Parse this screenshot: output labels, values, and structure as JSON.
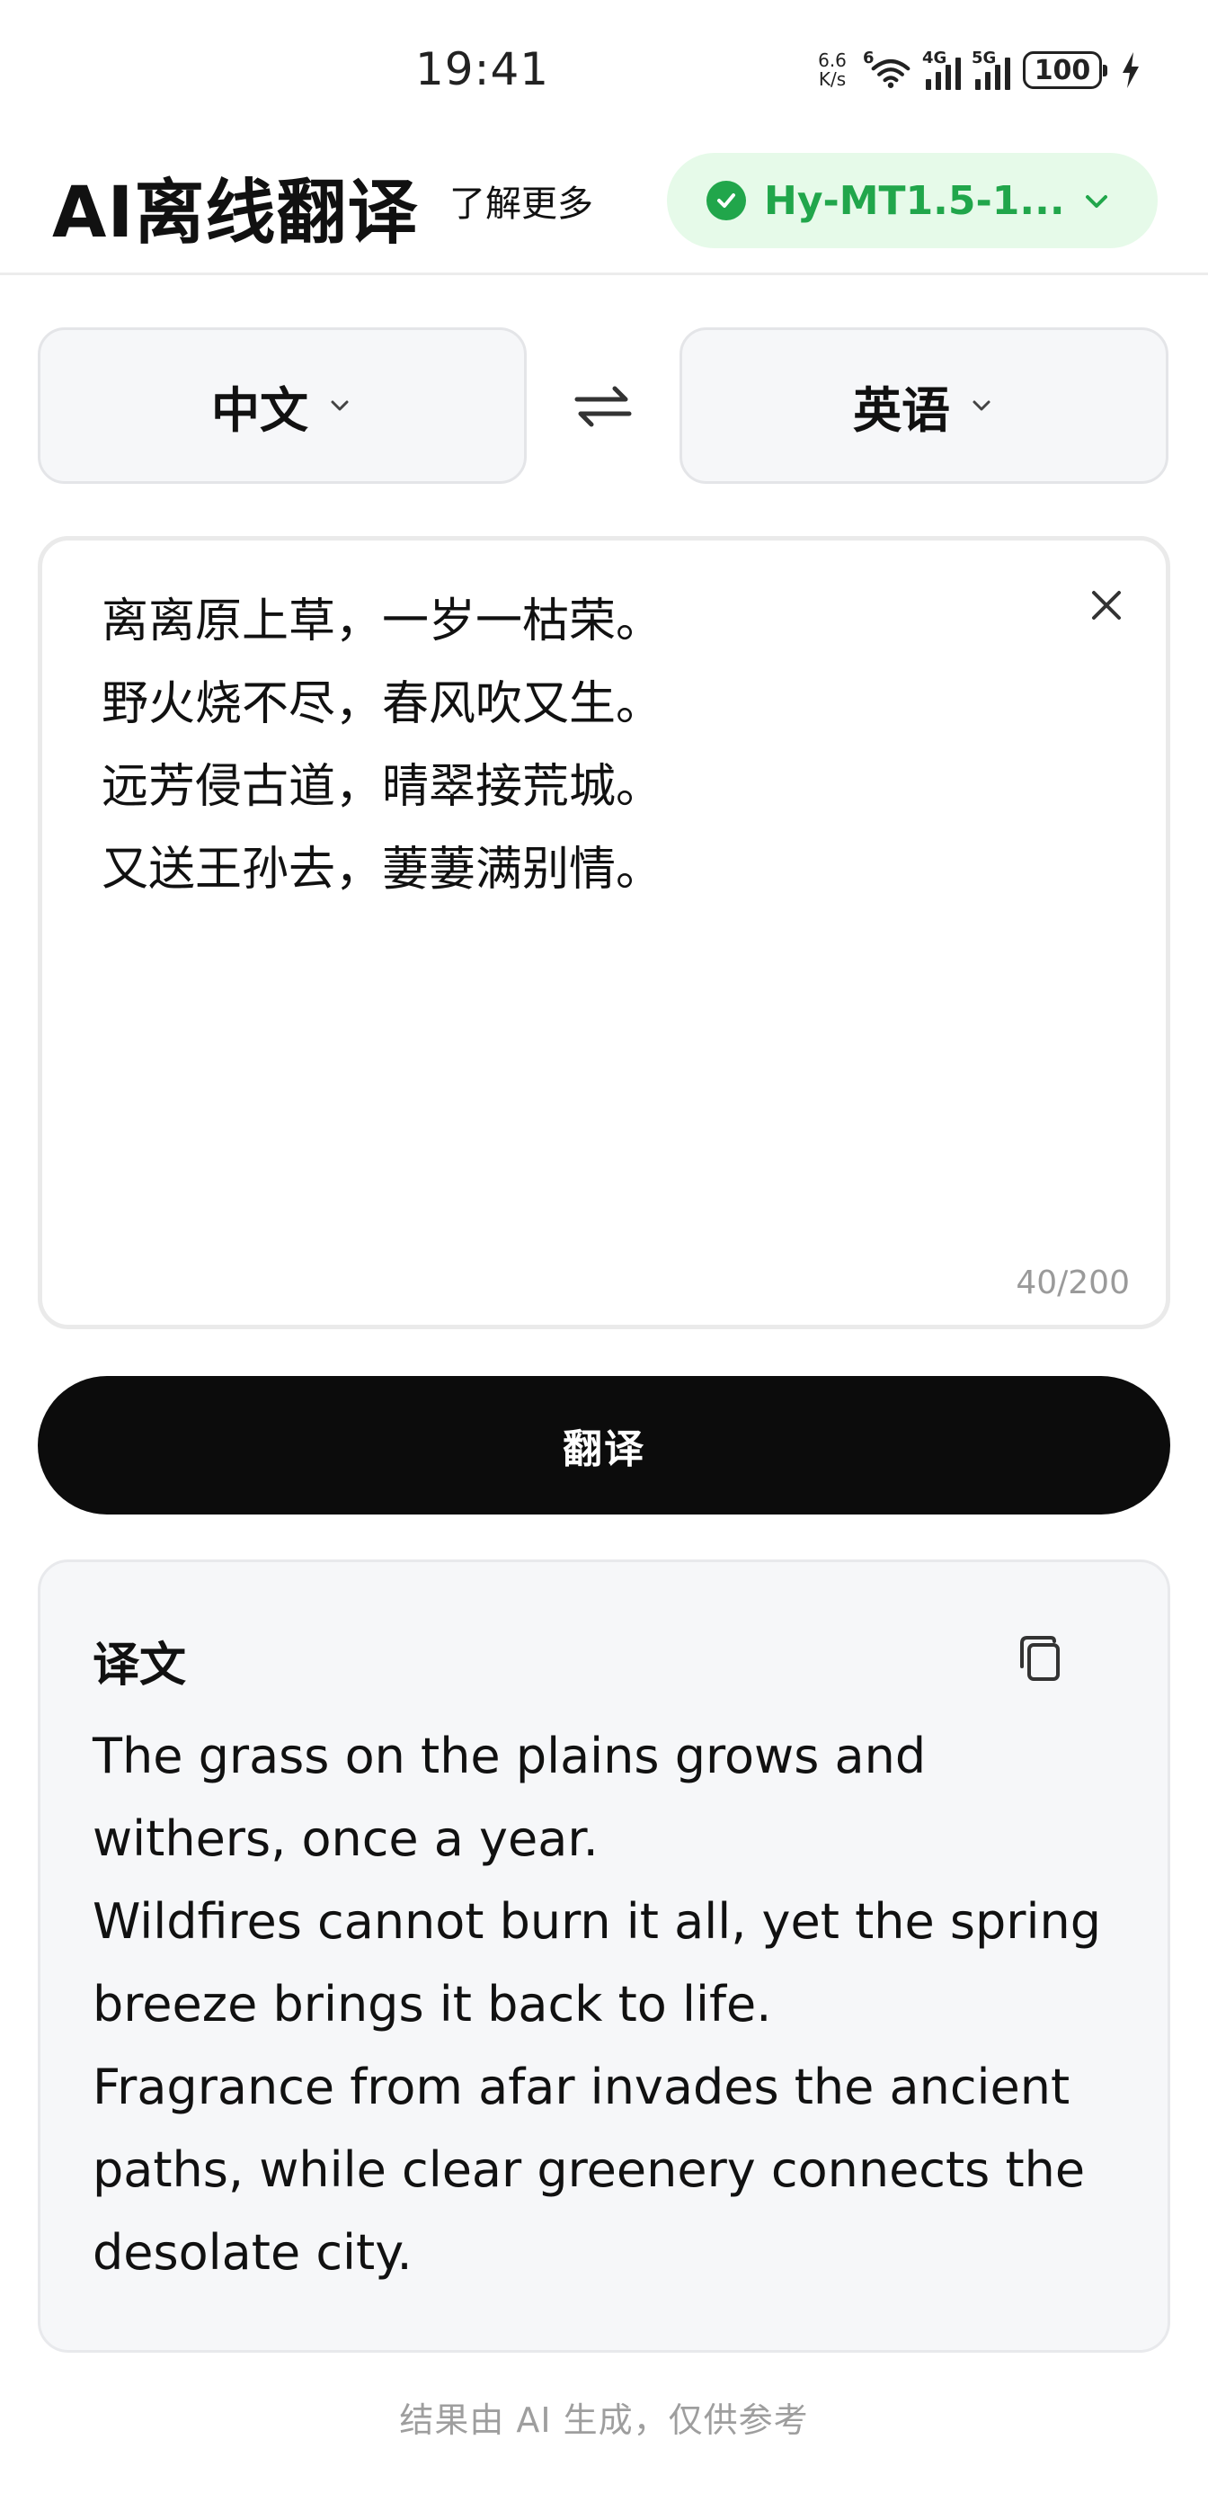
{
  "status_bar": {
    "time": "19:41",
    "net_speed_value": "6.6",
    "net_speed_unit": "K/s",
    "sig1_label": "6",
    "sig2_label": "4G",
    "sig3_label": "5G",
    "battery": "100"
  },
  "header": {
    "app_title": "AI离线翻译",
    "learn_more": "了解更多",
    "model_name": "Hy-MT1.5-1...",
    "accent_color": "#21a64b"
  },
  "languages": {
    "source": "中文",
    "target": "英语"
  },
  "input": {
    "lines": [
      "离离原上草，一岁一枯荣。",
      "野火烧不尽，春风吹又生。",
      "远芳侵古道，晴翠接荒城。",
      "又送王孙去，萋萋满别情。"
    ],
    "char_count": "40/200"
  },
  "translate_button": "翻译",
  "result": {
    "title": "译文",
    "lines": [
      "The grass on the plains grows and",
      "withers, once a year.",
      "Wildfires cannot burn it all, yet the spring",
      "breeze brings it back to life.",
      "Fragrance from afar invades the ancient",
      "paths, while clear greenery connects the",
      "desolate city."
    ]
  },
  "footer_note": "结果由 AI 生成，仅供参考",
  "icons": [
    "wifi-icon",
    "cellular-signal-icon",
    "battery-icon",
    "charging-bolt-icon",
    "check-circle-icon",
    "chevron-down-icon",
    "swap-languages-icon",
    "clear-icon",
    "copy-icon"
  ]
}
